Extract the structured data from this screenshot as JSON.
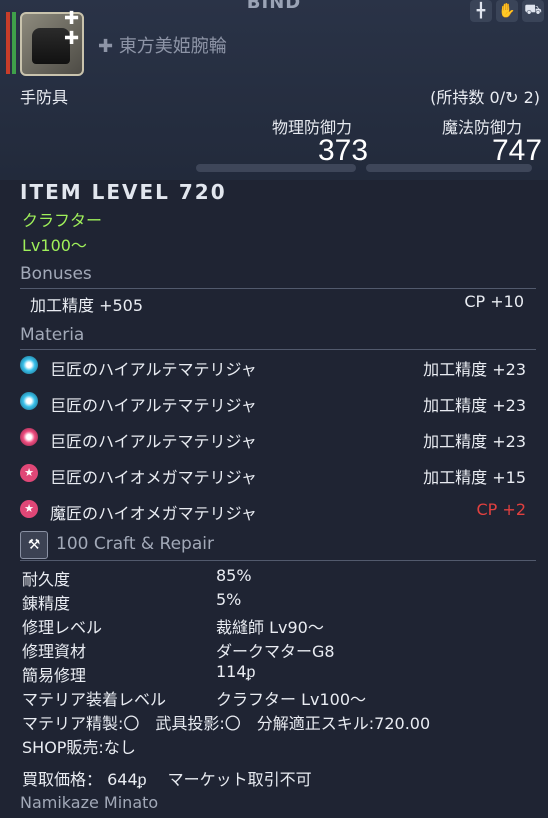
{
  "header": {
    "bind": "BIND",
    "item_name": "東方美姫腕輪",
    "category": "手防具",
    "owned": "(所持数 0/",
    "owned_suffix": " 2)",
    "physical_defense_label": "物理防御力",
    "physical_defense_value": "373",
    "magic_defense_label": "魔法防御力",
    "magic_defense_value": "747"
  },
  "item_level": "ITEM LEVEL 720",
  "class_job": "クラフター",
  "level": "Lv100～",
  "bonuses": {
    "title": "Bonuses",
    "left": "加工精度 +505",
    "right": "CP +10"
  },
  "materia": {
    "title": "Materia",
    "items": [
      {
        "name": "巨匠のハイアルテマテリジャ",
        "stat": "加工精度 +23",
        "icon": "materia-blue-icon"
      },
      {
        "name": "巨匠のハイアルテマテリジャ",
        "stat": "加工精度 +23",
        "icon": "materia-blue-icon"
      },
      {
        "name": "巨匠のハイアルテマテリジャ",
        "stat": "加工精度 +23",
        "icon": "materia-pink-icon"
      },
      {
        "name": "巨匠のハイオメガマテリジャ",
        "stat": "加工精度 +15",
        "icon": "materia-star-icon"
      },
      {
        "name": "魔匠のハイオメガマテリジャ",
        "stat": "CP +2",
        "icon": "materia-star-icon"
      }
    ]
  },
  "craft": {
    "title": "100 Craft & Repair",
    "rows": [
      {
        "label": "耐久度",
        "value": "85%"
      },
      {
        "label": "錬精度",
        "value": "5%"
      },
      {
        "label": "修理レベル",
        "value": "裁縫師 Lv90～"
      },
      {
        "label": "修理資材",
        "value": "ダークマターG8"
      },
      {
        "label": "簡易修理",
        "value": "114ᵱ"
      },
      {
        "label": "マテリア装着レベル",
        "value": "クラフター Lv100～"
      }
    ],
    "line1": "マテリア精製:〇　武具投影:〇　分解適正スキル:720.00",
    "line2": "SHOP販売:なし",
    "line3": "買取価格： 644ᵱ　 マーケット取引不可"
  },
  "crafter_name": "Namikaze Minato",
  "colors": {
    "class_green": "#9ff05a",
    "red": "#e0403f",
    "section_gray": "#a2a9b8"
  }
}
